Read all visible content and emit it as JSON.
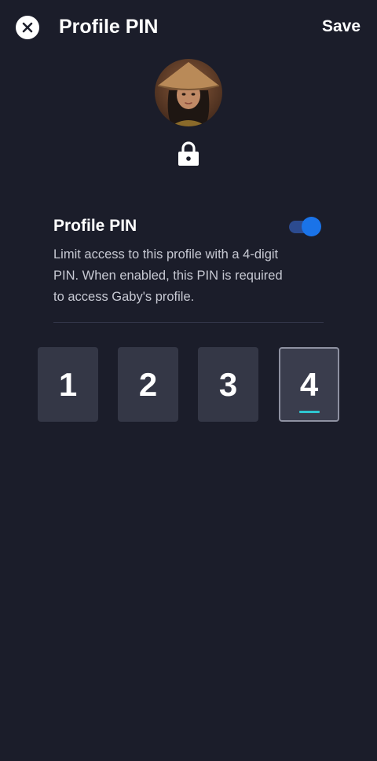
{
  "header": {
    "title": "Profile PIN",
    "save_label": "Save"
  },
  "pin_section": {
    "label": "Profile PIN",
    "toggle_on": true,
    "description": "Limit access to this profile with a 4-digit PIN. When enabled, this PIN is required to access Gaby's profile."
  },
  "pin": {
    "digits": [
      "1",
      "2",
      "3",
      "4"
    ],
    "active_index": 3
  },
  "colors": {
    "background": "#1b1d2a",
    "accent": "#1a73e8",
    "cursor": "#2fc5d0",
    "box": "#343746"
  },
  "icons": {
    "close": "close-icon",
    "lock": "lock-icon"
  }
}
